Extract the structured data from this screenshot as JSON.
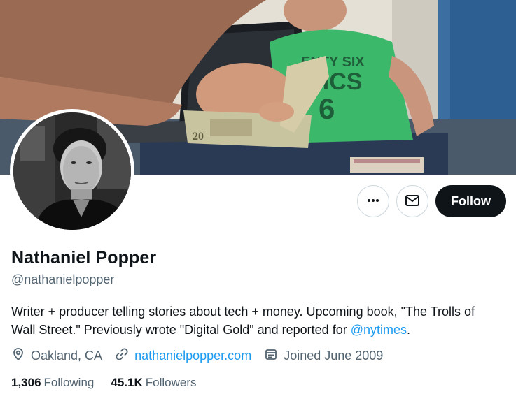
{
  "profile": {
    "name": "Nathaniel Popper",
    "handle": "@nathanielpopper",
    "bio_text": "Writer + producer telling stories about tech + money. Upcoming book, \"The Trolls of Wall Street.\" Previously wrote \"Digital Gold\" and reported for ",
    "bio_mention": "@nytimes",
    "bio_end": ".",
    "location": "Oakland, CA",
    "website": "nathanielpopper.com",
    "joined": "Joined June 2009"
  },
  "stats": {
    "following_count": "1,306",
    "following_label": "Following",
    "followers_count": "45.1K",
    "followers_label": "Followers"
  },
  "actions": {
    "follow_label": "Follow"
  },
  "icons": {
    "more": "more-icon",
    "message": "envelope-icon",
    "location": "location-pin-icon",
    "link": "link-icon",
    "calendar": "calendar-icon"
  },
  "colors": {
    "accent": "#1d9bf0",
    "text_primary": "#0f1419",
    "text_secondary": "#536471",
    "button_dark": "#0f1419"
  }
}
